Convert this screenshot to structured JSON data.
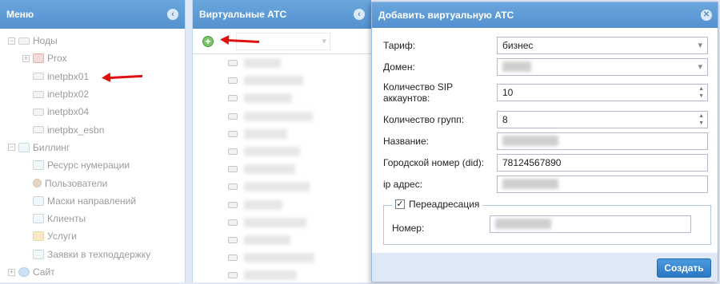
{
  "menu": {
    "title": "Меню",
    "items": [
      {
        "label": "Ноды",
        "level": 0,
        "icon": "server-group-icon",
        "expander": "minus"
      },
      {
        "label": "Prox",
        "level": 1,
        "icon": "server-red-icon",
        "expander": "plus"
      },
      {
        "label": "inetpbx01",
        "level": 1,
        "icon": "server-icon"
      },
      {
        "label": "inetpbx02",
        "level": 1,
        "icon": "server-icon"
      },
      {
        "label": "inetpbx04",
        "level": 1,
        "icon": "server-icon"
      },
      {
        "label": "inetpbx_esbn",
        "level": 1,
        "icon": "server-icon"
      },
      {
        "label": "Биллинг",
        "level": 0,
        "icon": "billing-icon",
        "expander": "minus"
      },
      {
        "label": "Ресурс нумерации",
        "level": 1,
        "icon": "document-icon"
      },
      {
        "label": "Пользователи",
        "level": 1,
        "icon": "user-icon"
      },
      {
        "label": "Маски направлений",
        "level": 1,
        "icon": "mask-icon"
      },
      {
        "label": "Клиенты",
        "level": 1,
        "icon": "clients-icon"
      },
      {
        "label": "Услуги",
        "level": 1,
        "icon": "folder-icon"
      },
      {
        "label": "Заявки в техподдержку",
        "level": 1,
        "icon": "ticket-icon"
      },
      {
        "label": "Сайт",
        "level": 0,
        "icon": "globe-icon",
        "expander": "plus"
      }
    ]
  },
  "vats": {
    "title": "Виртуальные АТС"
  },
  "dialog": {
    "title": "Добавить виртуальную АТС",
    "fields": {
      "tariff": {
        "label": "Тариф:",
        "value": "бизнес"
      },
      "domain": {
        "label": "Домен:"
      },
      "sip_accounts": {
        "label": "Количество SIP аккаунтов:",
        "value": "10"
      },
      "groups": {
        "label": "Количество групп:",
        "value": "8"
      },
      "name": {
        "label": "Название:"
      },
      "did": {
        "label": "Городской номер (did):",
        "value": "78124567890"
      },
      "ip": {
        "label": "ip адрес:"
      }
    },
    "forwarding": {
      "label": "Переадресация",
      "checked": true,
      "number_label": "Номер:"
    },
    "create_label": "Создать"
  },
  "colors": {
    "header": "#5491cf",
    "arrow": "#e01010",
    "button": "#2a77c4"
  }
}
